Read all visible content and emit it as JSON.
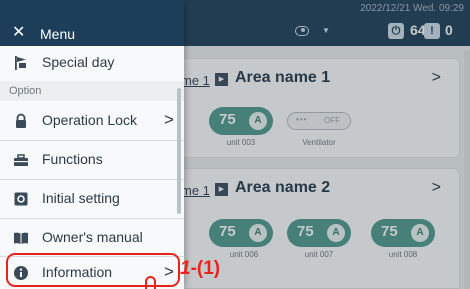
{
  "header": {
    "datetime": "2022/12/21 Wed. 09:29",
    "power_count": "64",
    "alert_count": "0",
    "power_icon_glyph": "⏻",
    "alert_icon_glyph": "!"
  },
  "menu": {
    "close_glyph": "✕",
    "title": "Menu",
    "section_option": "Option",
    "items": [
      {
        "label": "Special day",
        "icon": "flag-icon"
      },
      {
        "label": "Operation Lock",
        "icon": "lock-icon",
        "chevron": ">"
      },
      {
        "label": "Functions",
        "icon": "tools-icon"
      },
      {
        "label": "Initial setting",
        "icon": "settings-icon"
      },
      {
        "label": "Owner's manual",
        "icon": "book-icon"
      },
      {
        "label": "Information",
        "icon": "info-icon",
        "chevron": ">"
      }
    ]
  },
  "areas": [
    {
      "link": "me 1",
      "name": "Area name 1",
      "chevron": ">",
      "units": [
        {
          "value": "75",
          "mode": "A",
          "label": "unit 003"
        },
        {
          "dots": "•••",
          "status": "OFF",
          "label": "Ventilator"
        }
      ]
    },
    {
      "link": "me 1",
      "name": "Area name 2",
      "chevron": ">",
      "units": [
        {
          "value": "75",
          "mode": "A",
          "label": "unit 006"
        },
        {
          "value": "75",
          "mode": "A",
          "label": "unit 007"
        },
        {
          "value": "75",
          "mode": "A",
          "label": "unit 008"
        }
      ]
    }
  ],
  "annotation": {
    "step": "1",
    "sub": "-(1)"
  },
  "colors": {
    "header_bg": "#1c3e58",
    "accent_teal": "#4f9a8c",
    "highlight_red": "#e8231c"
  }
}
